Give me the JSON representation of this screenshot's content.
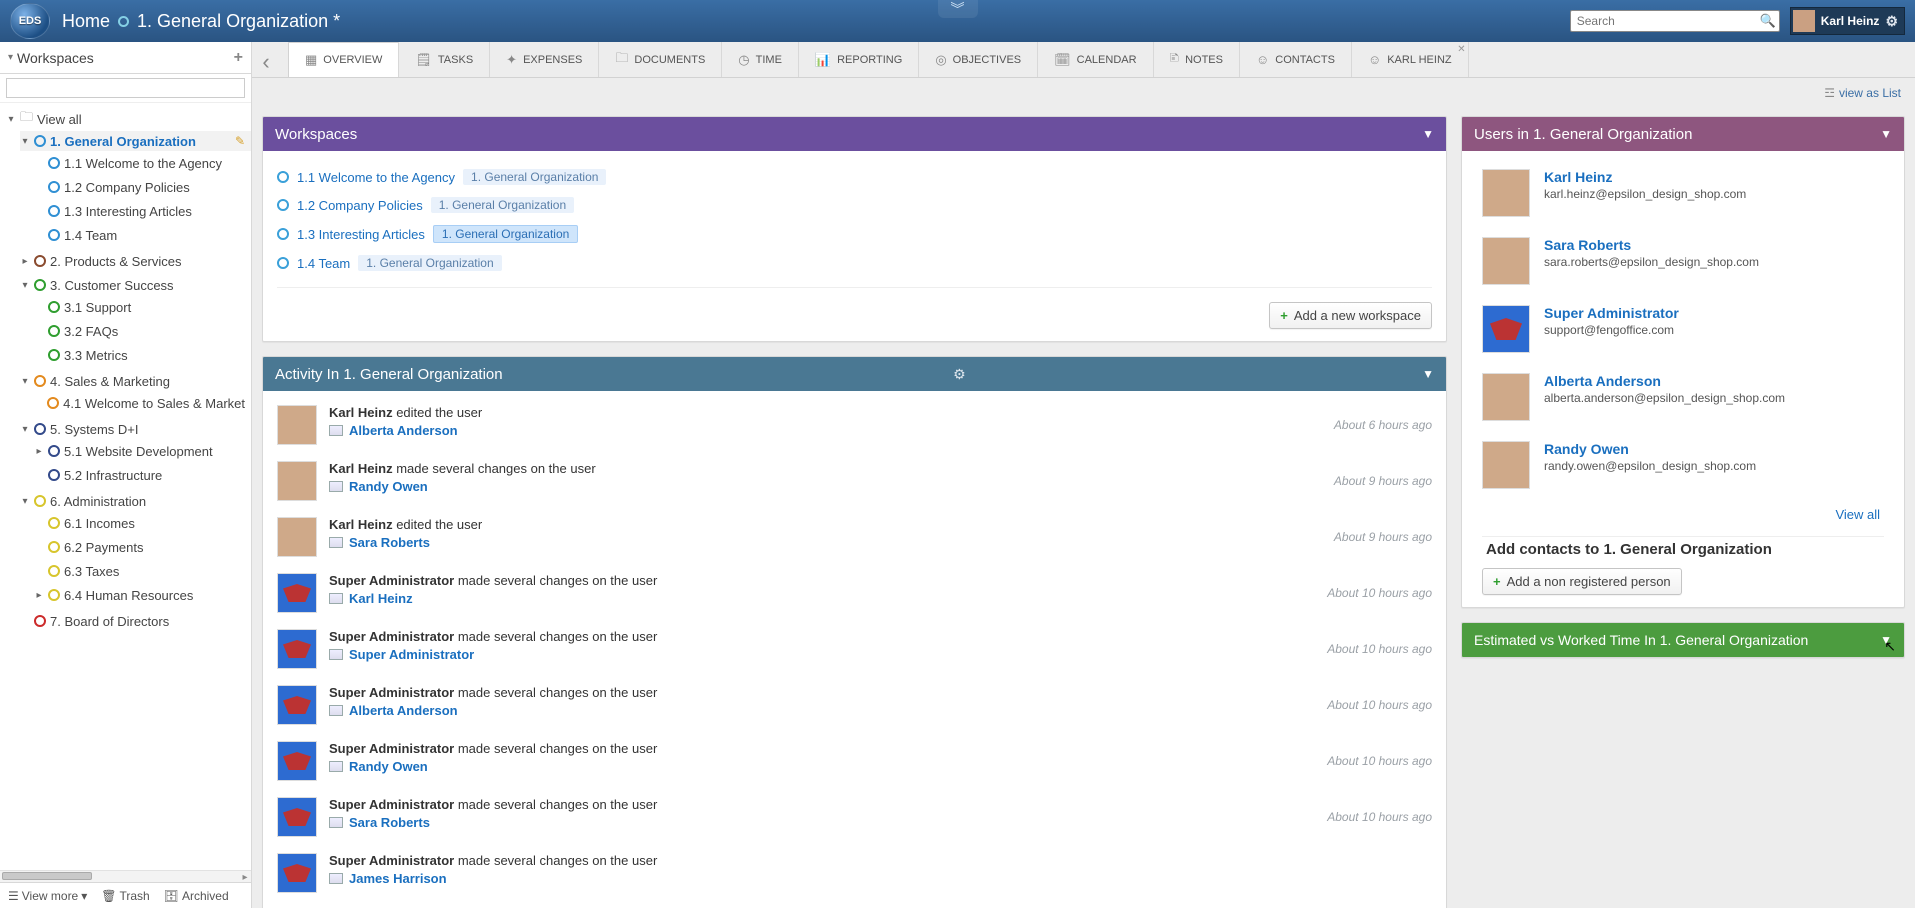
{
  "breadcrumb": {
    "home": "Home",
    "current": "1. General Organization *"
  },
  "search": {
    "placeholder": "Search"
  },
  "user": {
    "name": "Karl Heinz"
  },
  "sidebar": {
    "header": "Workspaces",
    "view_all": "View all",
    "view_more": "View more",
    "trash": "Trash",
    "archived": "Archived",
    "tree": [
      {
        "label": "1. General Organization",
        "color": "r-blue",
        "selected": true,
        "expand": "▾",
        "children": [
          {
            "label": "1.1 Welcome to the Agency",
            "color": "r-blue"
          },
          {
            "label": "1.2 Company Policies",
            "color": "r-blue"
          },
          {
            "label": "1.3 Interesting Articles",
            "color": "r-blue"
          },
          {
            "label": "1.4 Team",
            "color": "r-blue"
          }
        ]
      },
      {
        "label": "2. Products & Services",
        "color": "r-brown",
        "expand": "▸"
      },
      {
        "label": "3. Customer Success",
        "color": "r-green",
        "expand": "▾",
        "children": [
          {
            "label": "3.1 Support",
            "color": "r-green"
          },
          {
            "label": "3.2 FAQs",
            "color": "r-green"
          },
          {
            "label": "3.3 Metrics",
            "color": "r-green"
          }
        ]
      },
      {
        "label": "4. Sales & Marketing",
        "color": "r-orange",
        "expand": "▾",
        "children": [
          {
            "label": "4.1 Welcome to Sales & Market",
            "color": "r-orange"
          }
        ]
      },
      {
        "label": "5. Systems D+I",
        "color": "r-navy",
        "expand": "▾",
        "children": [
          {
            "label": "5.1 Website Development",
            "color": "r-navy",
            "expand": "▸"
          },
          {
            "label": "5.2 Infrastructure",
            "color": "r-navy"
          }
        ]
      },
      {
        "label": "6. Administration",
        "color": "r-yellow",
        "expand": "▾",
        "children": [
          {
            "label": "6.1 Incomes",
            "color": "r-yellow"
          },
          {
            "label": "6.2 Payments",
            "color": "r-yellow"
          },
          {
            "label": "6.3 Taxes",
            "color": "r-yellow"
          },
          {
            "label": "6.4 Human Resources",
            "color": "r-yellow",
            "expand": "▸"
          }
        ]
      },
      {
        "label": "7. Board of Directors",
        "color": "r-red"
      }
    ]
  },
  "tabs": [
    {
      "label": "OVERVIEW",
      "icon": "grid-icon"
    },
    {
      "label": "TASKS",
      "icon": "clipboard-icon"
    },
    {
      "label": "EXPENSES",
      "icon": "money-icon"
    },
    {
      "label": "DOCUMENTS",
      "icon": "folder-icon"
    },
    {
      "label": "TIME",
      "icon": "clock-icon"
    },
    {
      "label": "REPORTING",
      "icon": "chart-icon"
    },
    {
      "label": "OBJECTIVES",
      "icon": "target-icon"
    },
    {
      "label": "CALENDAR",
      "icon": "calendar-icon"
    },
    {
      "label": "NOTES",
      "icon": "note-icon"
    },
    {
      "label": "CONTACTS",
      "icon": "contact-icon"
    },
    {
      "label": "KARL HEINZ",
      "icon": "contact-icon",
      "closable": true
    }
  ],
  "meta": {
    "view_as_list": "view as List"
  },
  "workspaces_panel": {
    "title": "Workspaces",
    "items": [
      {
        "name": "1.1 Welcome to the Agency",
        "tag": "1. General Organization"
      },
      {
        "name": "1.2 Company Policies",
        "tag": "1. General Organization"
      },
      {
        "name": "1.3 Interesting Articles",
        "tag": "1. General Organization",
        "active": true
      },
      {
        "name": "1.4 Team",
        "tag": "1. General Organization"
      }
    ],
    "add_btn": "Add a new workspace"
  },
  "activity_panel": {
    "title": "Activity In 1. General Organization",
    "items": [
      {
        "actor": "Karl Heinz",
        "verb": "edited the user",
        "target": "Alberta Anderson",
        "time": "About 6 hours ago",
        "av": "person"
      },
      {
        "actor": "Karl Heinz",
        "verb": "made several changes on the user",
        "target": "Randy Owen",
        "time": "About 9 hours ago",
        "av": "person"
      },
      {
        "actor": "Karl Heinz",
        "verb": "edited the user",
        "target": "Sara Roberts",
        "time": "About 9 hours ago",
        "av": "person"
      },
      {
        "actor": "Super Administrator",
        "verb": "made several changes on the user",
        "target": "Karl Heinz",
        "time": "About 10 hours ago",
        "av": "sup"
      },
      {
        "actor": "Super Administrator",
        "verb": "made several changes on the user",
        "target": "Super Administrator",
        "time": "About 10 hours ago",
        "av": "sup"
      },
      {
        "actor": "Super Administrator",
        "verb": "made several changes on the user",
        "target": "Alberta Anderson",
        "time": "About 10 hours ago",
        "av": "sup"
      },
      {
        "actor": "Super Administrator",
        "verb": "made several changes on the user",
        "target": "Randy Owen",
        "time": "About 10 hours ago",
        "av": "sup"
      },
      {
        "actor": "Super Administrator",
        "verb": "made several changes on the user",
        "target": "Sara Roberts",
        "time": "About 10 hours ago",
        "av": "sup"
      },
      {
        "actor": "Super Administrator",
        "verb": "made several changes on the user",
        "target": "James Harrison",
        "time": "",
        "av": "sup"
      }
    ]
  },
  "users_panel": {
    "title": "Users in 1. General Organization",
    "items": [
      {
        "name": "Karl Heinz",
        "email": "karl.heinz@epsilon_design_shop.com",
        "av": "person"
      },
      {
        "name": "Sara Roberts",
        "email": "sara.roberts@epsilon_design_shop.com",
        "av": "person"
      },
      {
        "name": "Super Administrator",
        "email": "support@fengoffice.com",
        "av": "sup"
      },
      {
        "name": "Alberta Anderson",
        "email": "alberta.anderson@epsilon_design_shop.com",
        "av": "person"
      },
      {
        "name": "Randy Owen",
        "email": "randy.owen@epsilon_design_shop.com",
        "av": "person"
      }
    ],
    "view_all": "View all",
    "add_heading": "Add contacts to 1. General Organization",
    "add_btn": "Add a non registered person"
  },
  "estimated_panel": {
    "title": "Estimated vs Worked Time In 1. General Organization"
  }
}
